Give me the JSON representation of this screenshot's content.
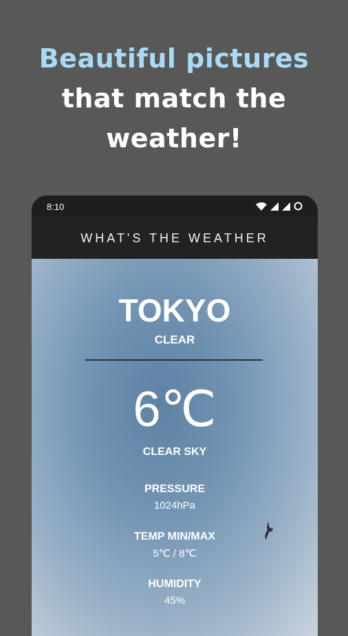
{
  "promo": {
    "line1": "Beautiful pictures",
    "line2": "that match the",
    "line3": "weather!"
  },
  "status_bar": {
    "time": "8:10",
    "icons": [
      "wifi-icon",
      "signal-icon",
      "signal-icon",
      "battery-icon"
    ]
  },
  "app_bar": {
    "title": "WHAT'S THE WEATHER"
  },
  "weather": {
    "city": "TOKYO",
    "condition": "CLEAR",
    "temperature": "6℃",
    "description": "CLEAR SKY",
    "pressure_label": "PRESSURE",
    "pressure_value": "1024hPa",
    "temp_label": "TEMP MIN/MAX",
    "temp_value": "5℃ / 8℃",
    "humidity_label": "HUMIDITY",
    "humidity_value": "45%"
  },
  "colors": {
    "background": "#585858",
    "accent_text": "#a9dcf4",
    "app_bar": "#222222"
  }
}
